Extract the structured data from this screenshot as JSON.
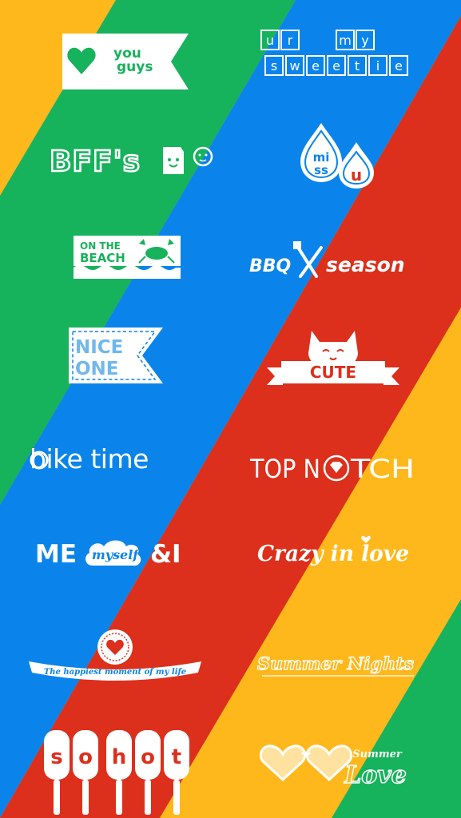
{
  "colors": {
    "yellow": "#FFB81C",
    "green": "#17B25C",
    "blue": "#0A84EA",
    "red": "#DC2F1C",
    "white": "#FFFFFF"
  },
  "stickers": {
    "you_guys": {
      "line1": "you",
      "line2": "guys"
    },
    "ur_my_sweetie": {
      "row1": [
        "u",
        "r",
        "",
        "m",
        "y"
      ],
      "row2": [
        "s",
        "w",
        "e",
        "e",
        "t",
        "i",
        "e"
      ]
    },
    "bffs": {
      "text": "BFF's"
    },
    "miss_u": {
      "line1": "mi",
      "line2": "ss",
      "letter": "u"
    },
    "on_the_beach": {
      "line1": "ON THE",
      "line2": "BEACH"
    },
    "bbq_season": {
      "left": "BBQ",
      "right": "season"
    },
    "nice_one": {
      "line1": "NICE",
      "line2": "ONE"
    },
    "cute": {
      "text": "CUTE"
    },
    "bike_time": {
      "text": "bike time"
    },
    "top_notch": {
      "left": "TOP N",
      "right": "TCH"
    },
    "me_myself_i": {
      "left": "ME",
      "middle": "myself",
      "right": "&I"
    },
    "crazy_in_love": {
      "text": "Crazy in love"
    },
    "happiest_moment": {
      "text": "The happiest moment of my life"
    },
    "summer_nights": {
      "text": "Summer Nights"
    },
    "so_hot": {
      "letters": [
        "s",
        "o",
        "h",
        "o",
        "t"
      ]
    },
    "summer_love": {
      "line1": "Summer",
      "line2": "Love"
    }
  }
}
